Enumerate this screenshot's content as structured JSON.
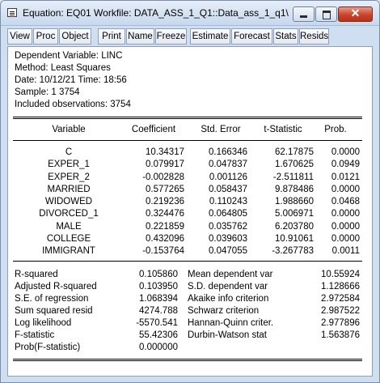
{
  "window": {
    "title": "Equation: EQ01   Workfile: DATA_ASS_1_Q1::Data_ass_1_q1\\",
    "close_label": "✕"
  },
  "toolbar": [
    "View",
    "Proc",
    "Object",
    "Print",
    "Name",
    "Freeze",
    "Estimate",
    "Forecast",
    "Stats",
    "Resids"
  ],
  "header": [
    "Dependent Variable: LINC",
    "Method: Least Squares",
    "Date: 10/12/21   Time: 18:56",
    "Sample: 1 3754",
    "Included observations: 3754"
  ],
  "columns": [
    "Variable",
    "Coefficient",
    "Std. Error",
    "t-Statistic",
    "Prob."
  ],
  "rows": [
    [
      "C",
      "10.34317",
      "0.166346",
      "62.17875",
      "0.0000"
    ],
    [
      "EXPER_1",
      "0.079917",
      "0.047837",
      "1.670625",
      "0.0949"
    ],
    [
      "EXPER_2",
      "-0.002828",
      "0.001126",
      "-2.511811",
      "0.0121"
    ],
    [
      "MARRIED",
      "0.577265",
      "0.058437",
      "9.878486",
      "0.0000"
    ],
    [
      "WIDOWED",
      "0.219236",
      "0.110243",
      "1.988660",
      "0.0468"
    ],
    [
      "DIVORCED_1",
      "0.324476",
      "0.064805",
      "5.006971",
      "0.0000"
    ],
    [
      "MALE",
      "0.221859",
      "0.035762",
      "6.203780",
      "0.0000"
    ],
    [
      "COLLEGE",
      "0.432096",
      "0.039603",
      "10.91061",
      "0.0000"
    ],
    [
      "IMMIGRANT",
      "-0.153764",
      "0.047055",
      "-3.267783",
      "0.0011"
    ]
  ],
  "stats": [
    [
      "R-squared",
      "0.105860",
      "Mean dependent var",
      "10.55924"
    ],
    [
      "Adjusted R-squared",
      "0.103950",
      "S.D. dependent var",
      "1.128666"
    ],
    [
      "S.E. of regression",
      "1.068394",
      "Akaike info criterion",
      "2.972584"
    ],
    [
      "Sum squared resid",
      "4274.788",
      "Schwarz criterion",
      "2.987522"
    ],
    [
      "Log likelihood",
      "-5570.541",
      "Hannan-Quinn criter.",
      "2.977896"
    ],
    [
      "F-statistic",
      "55.42306",
      "Durbin-Watson stat",
      "1.563876"
    ],
    [
      "Prob(F-statistic)",
      "0.000000",
      "",
      ""
    ]
  ]
}
